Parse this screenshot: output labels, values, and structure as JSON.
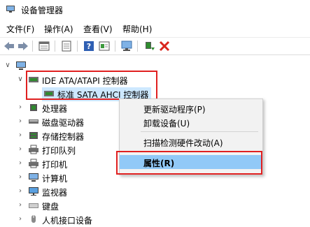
{
  "window": {
    "title": "设备管理器"
  },
  "menu": [
    "文件(F)",
    "操作(A)",
    "查看(V)",
    "帮助(H)"
  ],
  "tree": {
    "root_label": "",
    "ide_group": "IDE ATA/ATAPI 控制器",
    "ide_child": "标准 SATA AHCI 控制器",
    "items": [
      "处理器",
      "磁盘驱动器",
      "存储控制器",
      "打印队列",
      "打印机",
      "计算机",
      "监视器",
      "键盘",
      "人机接口设备"
    ]
  },
  "context_menu": {
    "items": [
      "更新驱动程序(P)",
      "卸载设备(U)",
      "扫描检测硬件改动(A)",
      "属性(R)"
    ]
  },
  "colors": {
    "highlight_red": "#e02020",
    "menu_highlight": "#91c9f7",
    "selection": "#cde8ff"
  }
}
